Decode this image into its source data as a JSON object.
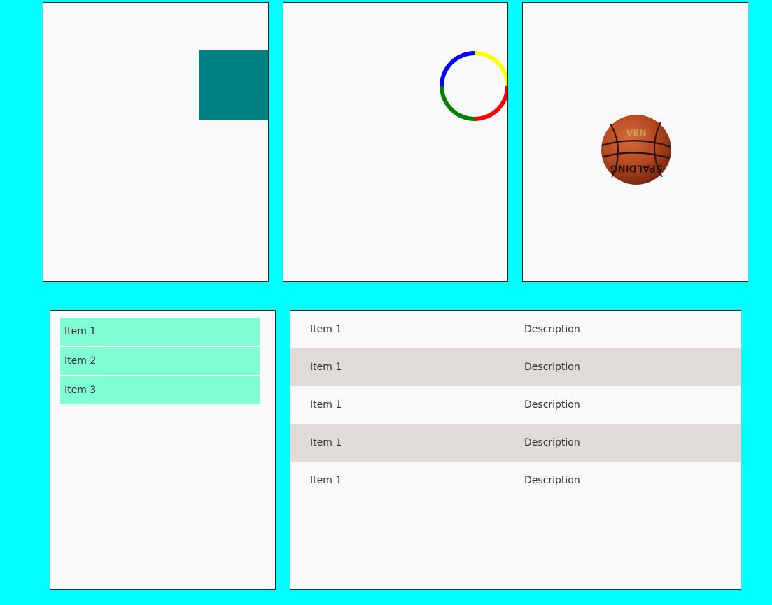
{
  "colors": {
    "background": "#00FFFF",
    "panel": "#F9F9F9",
    "teal_square": "#008080",
    "list_item": "#7FFFD4",
    "row_alt": "#DFDBD7",
    "ring": [
      "#FFFF00",
      "#FF0000",
      "#008000",
      "#0000FF"
    ]
  },
  "ball": {
    "icon": "basketball-icon",
    "brand": "SPALDING",
    "league": "NBA"
  },
  "list": {
    "items": [
      {
        "label": "Item 1"
      },
      {
        "label": "Item 2"
      },
      {
        "label": "Item 3"
      }
    ]
  },
  "table": {
    "rows": [
      {
        "item": "Item 1",
        "description": "Description"
      },
      {
        "item": "Item 1",
        "description": "Description"
      },
      {
        "item": "Item 1",
        "description": "Description"
      },
      {
        "item": "Item 1",
        "description": "Description"
      },
      {
        "item": "Item 1",
        "description": "Description"
      }
    ]
  }
}
